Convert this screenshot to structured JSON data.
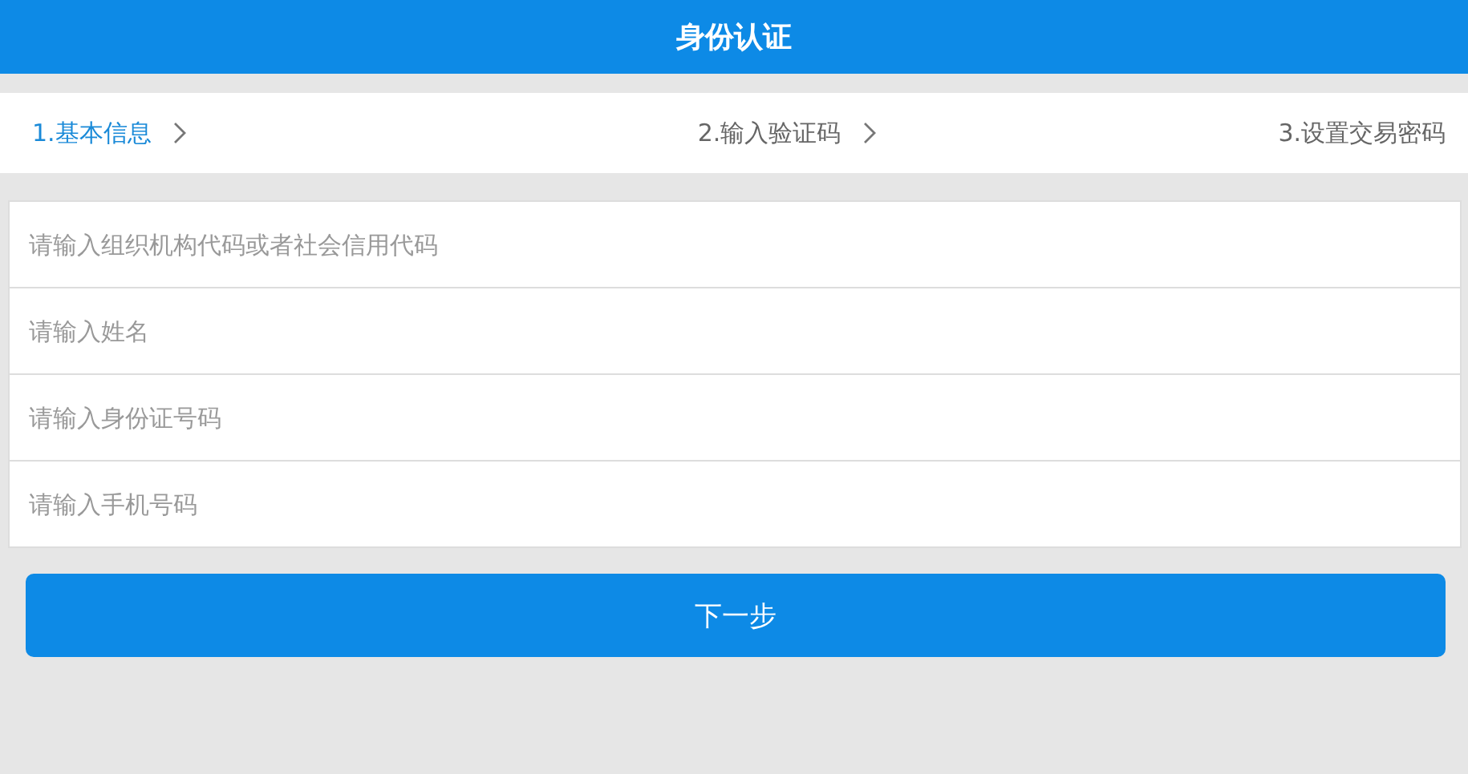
{
  "header": {
    "title": "身份认证"
  },
  "steps": [
    {
      "label": "1.基本信息",
      "selected": true
    },
    {
      "label": "2.输入验证码",
      "selected": false
    },
    {
      "label": "3.设置交易密码",
      "selected": false
    }
  ],
  "fields": [
    {
      "placeholder": "请输入组织机构代码或者社会信用代码"
    },
    {
      "placeholder": "请输入姓名"
    },
    {
      "placeholder": "请输入身份证号码"
    },
    {
      "placeholder": "请输入手机号码"
    }
  ],
  "next_button": {
    "label": "下一步"
  }
}
